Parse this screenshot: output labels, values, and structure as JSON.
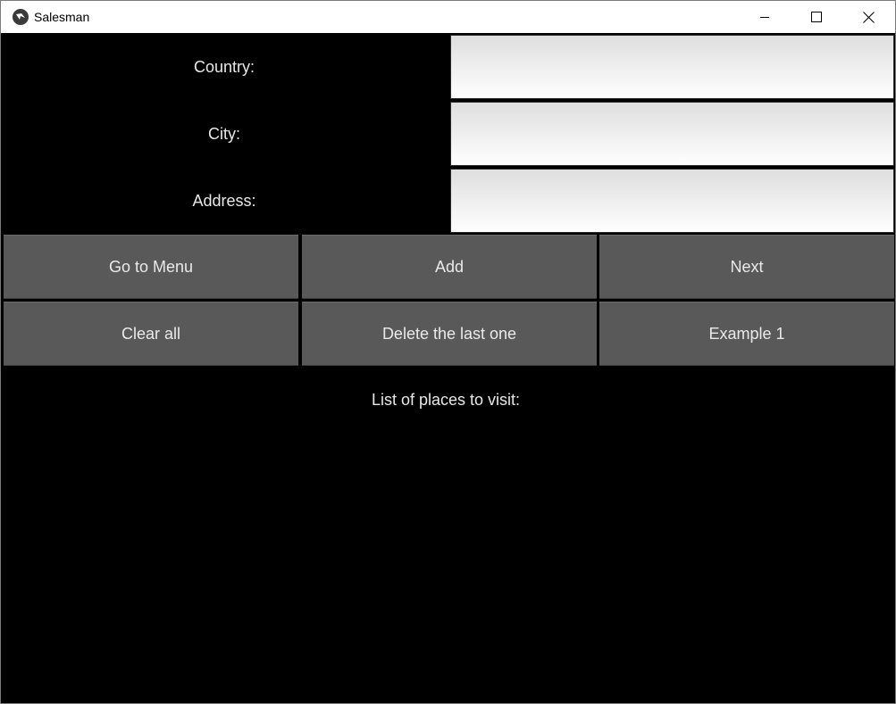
{
  "window": {
    "title": "Salesman",
    "icon": "kivy-logo-icon"
  },
  "form": {
    "country_label": "Country:",
    "city_label": "City:",
    "address_label": "Address:",
    "country_value": "",
    "city_value": "",
    "address_value": ""
  },
  "buttons": {
    "go_to_menu": "Go to Menu",
    "add": "Add",
    "next": "Next",
    "clear_all": "Clear all",
    "delete_last": "Delete the last one",
    "example_1": "Example 1"
  },
  "places": {
    "title": "List of places to visit:",
    "items": []
  }
}
